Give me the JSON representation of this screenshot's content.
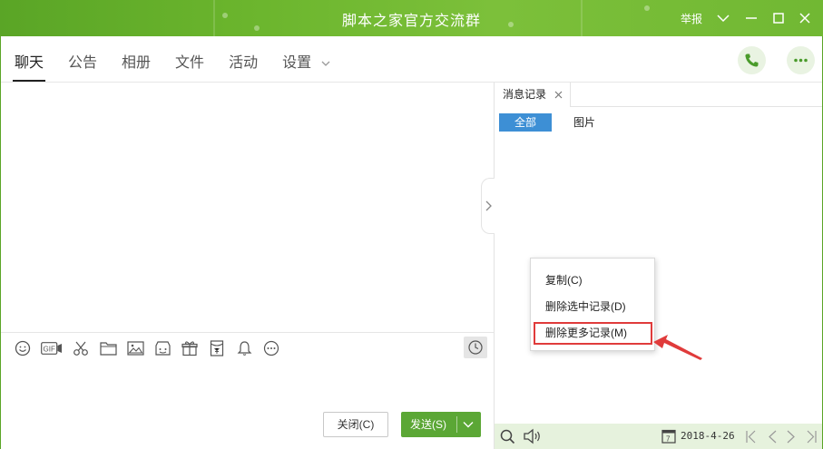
{
  "window": {
    "title": "脚本之家官方交流群",
    "report_label": "举报",
    "colors": {
      "titlebar": "#6bb52d",
      "accent_green": "#5ba735",
      "accent_blue": "#3d8fd5",
      "highlight_red": "#e03b3b"
    }
  },
  "tabs": [
    {
      "label": "聊天",
      "active": true
    },
    {
      "label": "公告"
    },
    {
      "label": "相册"
    },
    {
      "label": "文件"
    },
    {
      "label": "活动"
    },
    {
      "label": "设置"
    }
  ],
  "header_actions": {
    "call_icon": "phone-icon",
    "more_icon": "more-dots-icon"
  },
  "toolbar": {
    "icons": [
      "emoji-icon",
      "gif-icon",
      "scissors-icon",
      "folder-icon",
      "image-icon",
      "shop-icon",
      "gift-icon",
      "red-packet-icon",
      "bell-icon",
      "more-icon"
    ],
    "gif_label": "GIF",
    "history_icon": "clock-icon"
  },
  "buttons": {
    "close_label": "关闭(C)",
    "send_label": "发送(S)"
  },
  "right_panel": {
    "tab_label": "消息记录",
    "filters": {
      "all": "全部",
      "images": "图片"
    },
    "context_menu": [
      {
        "label": "复制(C)"
      },
      {
        "label": "删除选中记录(D)"
      },
      {
        "label": "删除更多记录(M)",
        "highlighted": true
      }
    ],
    "status": {
      "date": "2018-4-26",
      "calendar_day": "7"
    }
  }
}
